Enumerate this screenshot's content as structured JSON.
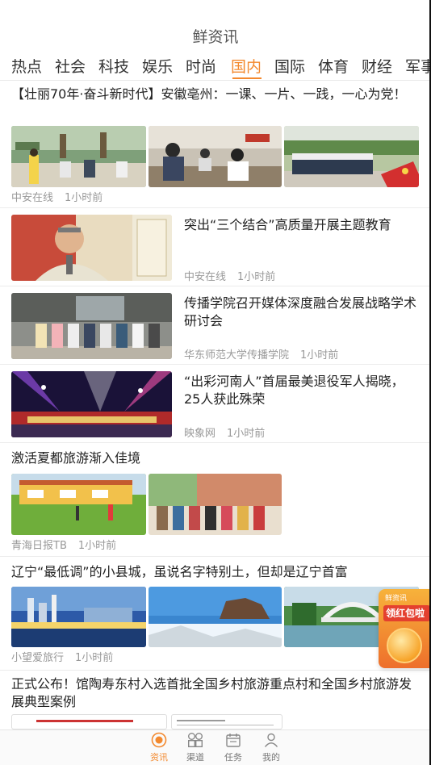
{
  "header": {
    "title": "鲜资讯"
  },
  "tabs": [
    "热点",
    "社会",
    "科技",
    "娱乐",
    "时尚",
    "国内",
    "国际",
    "体育",
    "财经",
    "军事"
  ],
  "active_tab": "国内",
  "articles": [
    {
      "title": "【壮丽70年·奋斗新时代】安徽亳州：一课、一片、一践，一心为党！",
      "source": "中安在线",
      "time": "1小时前"
    },
    {
      "title": "突出“三个结合”高质量开展主题教育",
      "source": "中安在线",
      "time": "1小时前"
    },
    {
      "title": "传播学院召开媒体深度融合发展战略学术研讨会",
      "source": "华东师范大学传播学院",
      "time": "1小时前"
    },
    {
      "title": "“出彩河南人”首届最美退役军人揭晓，25人获此殊荣",
      "source": "映象网",
      "time": "1小时前"
    },
    {
      "title": "激活夏都旅游渐入佳境",
      "source": "青海日报TB",
      "time": "1小时前"
    },
    {
      "title": "辽宁“最低调”的小县城，虽说名字特别土，但却是辽宁首富",
      "source": "小望爱旅行",
      "time": "1小时前"
    },
    {
      "title": "正式公布！馆陶寿东村入选首批全国乡村旅游重点村和全国乡村旅游发展典型案例",
      "source": "",
      "time": ""
    }
  ],
  "promo": {
    "tag": "鲜资讯",
    "text": "领红包啦"
  },
  "bottom_nav": [
    {
      "label": "资讯",
      "icon": "news-icon",
      "active": true
    },
    {
      "label": "渠道",
      "icon": "grid-icon",
      "active": false
    },
    {
      "label": "任务",
      "icon": "calendar-icon",
      "active": false
    },
    {
      "label": "我的",
      "icon": "user-icon",
      "active": false
    }
  ]
}
